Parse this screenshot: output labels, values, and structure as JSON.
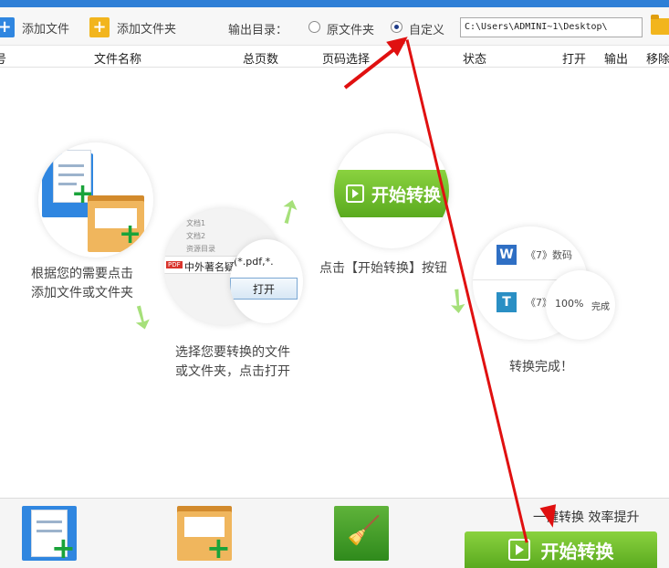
{
  "toolbar": {
    "add_file_label": "添加文件",
    "add_folder_label": "添加文件夹",
    "output_dir_label": "输出目录：",
    "option_original": "原文件夹",
    "option_custom": "自定义",
    "selected_option": "自定义",
    "output_path": "C:\\Users\\ADMINI~1\\Desktop\\"
  },
  "table_header": {
    "columns": [
      "号",
      "文件名称",
      "总页数",
      "页码选择",
      "状态",
      "打开",
      "输出",
      "移除"
    ]
  },
  "guide": {
    "step1_text_line1": "根据您的需要点击",
    "step1_text_line2": "添加文件或文件夹",
    "step2_file_name": "中外著名疑",
    "step2_filter": "(*.pdf,*.",
    "step2_open_button": "打开",
    "step2_pdf_badge": "PDF",
    "step2_folder_items": [
      "文档1",
      "文档2",
      "资源目录"
    ],
    "step2_text_line1": "选择您要转换的文件",
    "step2_text_line2": "或文件夹，点击打开",
    "step3_button": "开始转换",
    "step3_text": "点击【开始转换】按钮",
    "step4_item1_icon": "W",
    "step4_item1_name": "《7》数码",
    "step4_item2_icon": "T",
    "step4_item2_name": "《7》",
    "step4_progress": "100%",
    "step4_status": "完成",
    "step4_text": "转换完成！"
  },
  "bottom": {
    "slogan": "一键转换  效率提升",
    "start_button": "开始转换"
  },
  "colors": {
    "accent_blue": "#2f86e0",
    "accent_green": "#5aaa1f",
    "annotation_red": "#e01010"
  }
}
